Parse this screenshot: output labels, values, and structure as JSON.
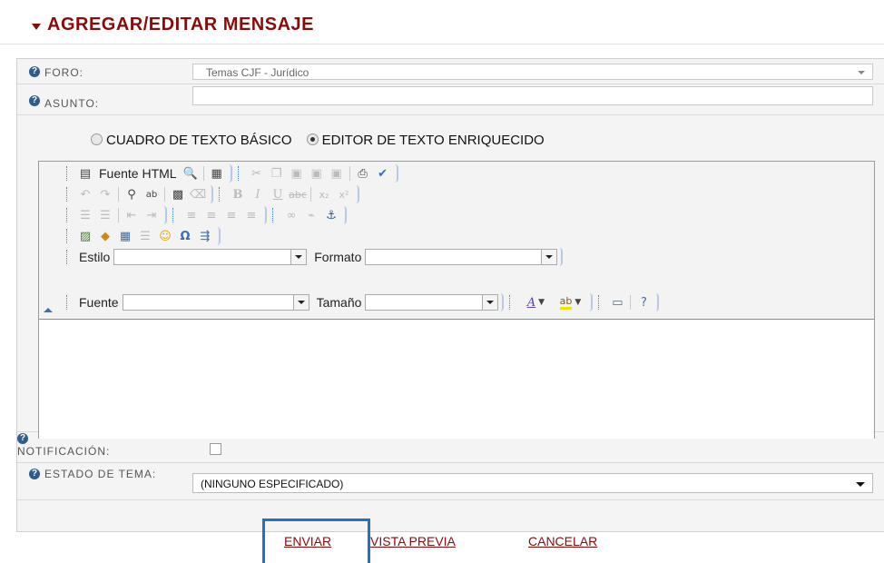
{
  "header": {
    "title": "AGREGAR/EDITAR MENSAJE"
  },
  "fields": {
    "foro_label": "FORO:",
    "foro_value": "Temas CJF - Jurídico",
    "asunto_label": "ASUNTO:",
    "asunto_value": ""
  },
  "editor_mode": {
    "basic_label": "CUADRO DE TEXTO BÁSICO",
    "rich_label": "EDITOR DE TEXTO ENRIQUECIDO",
    "selected": "rich"
  },
  "toolbar": {
    "source_label": "Fuente HTML",
    "style_label": "Estilo",
    "format_label": "Formato",
    "font_label": "Fuente",
    "size_label": "Tamaño",
    "style_value": "",
    "format_value": "",
    "font_value": "",
    "size_value": "",
    "icons_row1": [
      "source-icon",
      "preview-icon",
      "templates-icon",
      "cut-icon",
      "copy-icon",
      "paste-icon",
      "paste-text-icon",
      "paste-word-icon",
      "print-icon",
      "spellcheck-icon"
    ],
    "icons_row2": [
      "undo-icon",
      "redo-icon",
      "find-icon",
      "replace-icon",
      "select-all-icon",
      "remove-format-icon",
      "bold-icon",
      "italic-icon",
      "underline-icon",
      "strike-icon",
      "subscript-icon",
      "superscript-icon"
    ],
    "icons_row3": [
      "numbered-list-icon",
      "bulleted-list-icon",
      "outdent-icon",
      "indent-icon",
      "align-left-icon",
      "align-center-icon",
      "align-right-icon",
      "justify-icon",
      "link-icon",
      "unlink-icon",
      "anchor-icon"
    ],
    "icons_row4": [
      "image-icon",
      "flash-icon",
      "table-icon",
      "horizontal-rule-icon",
      "smiley-icon",
      "special-char-icon",
      "page-break-icon"
    ],
    "icons_row6": [
      "text-color-icon",
      "bg-color-icon",
      "maximize-icon",
      "about-icon"
    ],
    "text_color_glyph": "A",
    "bg_color_glyph": "ab"
  },
  "notification": {
    "label": "NOTIFICACIÓN:",
    "checked": false
  },
  "estado": {
    "label": "ESTADO DE TEMA:",
    "value": "(NINGUNO ESPECIFICADO)"
  },
  "actions": {
    "send": "ENVIAR",
    "preview": "VISTA PREVIA",
    "cancel": "CANCELAR"
  },
  "colors": {
    "brand": "#8b0a0a",
    "focus": "#1e73c7",
    "help": "#2d5c8e"
  }
}
